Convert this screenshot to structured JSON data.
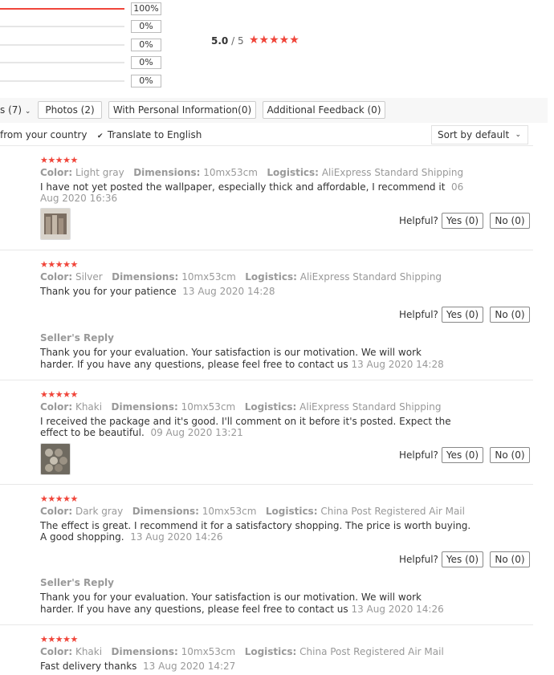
{
  "summary": {
    "bars": [
      {
        "pct": "100%",
        "fill": 1.0
      },
      {
        "pct": "0%",
        "fill": 0
      },
      {
        "pct": "0%",
        "fill": 0
      },
      {
        "pct": "0%",
        "fill": 0
      },
      {
        "pct": "0%",
        "fill": 0
      }
    ],
    "score": "5.0",
    "score_den": "/ 5",
    "stars": "★★★★★"
  },
  "filters": {
    "partial": "s (7)",
    "photos": "Photos (2)",
    "personal": "With Personal Information(0)",
    "additional": "Additional Feedback (0)"
  },
  "options": {
    "country": "from your country",
    "translate": "Translate to English",
    "sort": "Sort by default"
  },
  "labels": {
    "color": "Color:",
    "dimensions": "Dimensions:",
    "logistics": "Logistics:",
    "helpful": "Helpful?",
    "yes": "Yes (0)",
    "no": "No (0)",
    "seller_reply": "Seller's Reply"
  },
  "reviews": [
    {
      "stars": "★★★★★",
      "color": "Light gray",
      "dimensions": "10mx53cm",
      "logistics": "AliExpress Standard Shipping",
      "text": "I have not yet posted the wallpaper, especially thick and affordable, I recommend it",
      "date": "06 Aug 2020 16:36",
      "has_photo": true
    },
    {
      "stars": "★★★★★",
      "color": "Silver",
      "dimensions": "10mx53cm",
      "logistics": "AliExpress Standard Shipping",
      "text": "Thank you for your patience",
      "date": "13 Aug 2020 14:28",
      "reply": "Thank you for your evaluation. Your satisfaction is our motivation. We will work harder. If you have any questions, please feel free to contact us",
      "reply_date": "13 Aug 2020 14:28"
    },
    {
      "stars": "★★★★★",
      "color": "Khaki",
      "dimensions": "10mx53cm",
      "logistics": "AliExpress Standard Shipping",
      "text": "I received the package and it's good. I'll comment on it before it's posted. Expect the effect to be beautiful.",
      "date": "09 Aug 2020 13:21",
      "has_photo": true
    },
    {
      "stars": "★★★★★",
      "color": "Dark gray",
      "dimensions": "10mx53cm",
      "logistics": "China Post Registered Air Mail",
      "text": "The effect is great. I recommend it for a satisfactory shopping. The price is worth buying. A good shopping.",
      "date": "13 Aug 2020 14:26",
      "reply": "Thank you for your evaluation. Your satisfaction is our motivation. We will work harder. If you have any questions, please feel free to contact us",
      "reply_date": "13 Aug 2020 14:26"
    },
    {
      "stars": "★★★★★",
      "color": "Khaki",
      "dimensions": "10mx53cm",
      "logistics": "China Post Registered Air Mail",
      "text": "Fast delivery thanks",
      "date": "13 Aug 2020 14:27"
    }
  ]
}
